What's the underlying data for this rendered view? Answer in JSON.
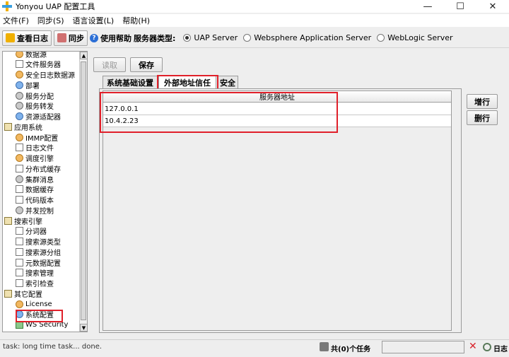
{
  "window": {
    "title": "Yonyou UAP 配置工具",
    "minimize": "—",
    "maximize": "☐",
    "close": "✕"
  },
  "menu": [
    "文件(F)",
    "同步(S)",
    "语言设置(L)",
    "帮助(H)"
  ],
  "toolbar": {
    "view_log": "查看日志",
    "sync": "同步",
    "help": "使用帮助",
    "server_type_label": "服务器类型:",
    "server_options": [
      {
        "label": "UAP Server",
        "selected": true
      },
      {
        "label": "Websphere Application Server",
        "selected": false
      },
      {
        "label": "WebLogic Server",
        "selected": false
      }
    ]
  },
  "tree": [
    {
      "label": "数据源",
      "icon": "datasource-icon",
      "level": 1
    },
    {
      "label": "文件服务器",
      "icon": "file-server-icon",
      "level": 1
    },
    {
      "label": "安全日志数据源",
      "icon": "datasource-icon",
      "level": 1
    },
    {
      "label": "部署",
      "icon": "deploy-icon",
      "level": 1
    },
    {
      "label": "服务分配",
      "icon": "service-icon",
      "level": 1
    },
    {
      "label": "服务转发",
      "icon": "service-icon",
      "level": 1
    },
    {
      "label": "资源适配器",
      "icon": "adapter-icon",
      "level": 1
    },
    {
      "label": "应用系统",
      "icon": "folder-icon",
      "level": 0
    },
    {
      "label": "IMMP配置",
      "icon": "config-icon",
      "level": 1
    },
    {
      "label": "日志文件",
      "icon": "log-icon",
      "level": 1
    },
    {
      "label": "调度引擎",
      "icon": "clock-icon",
      "level": 1
    },
    {
      "label": "分布式缓存",
      "icon": "doc-icon",
      "level": 1
    },
    {
      "label": "集群消息",
      "icon": "message-icon",
      "level": 1
    },
    {
      "label": "数据缓存",
      "icon": "cache-icon",
      "level": 1
    },
    {
      "label": "代码版本",
      "icon": "doc-icon",
      "level": 1
    },
    {
      "label": "并发控制",
      "icon": "list-icon",
      "level": 1
    },
    {
      "label": "搜索引擎",
      "icon": "folder-icon",
      "level": 0
    },
    {
      "label": "分词器",
      "icon": "doc-icon",
      "level": 1
    },
    {
      "label": "搜索源类型",
      "icon": "doc-icon",
      "level": 1
    },
    {
      "label": "搜索源分组",
      "icon": "doc-icon",
      "level": 1
    },
    {
      "label": "元数据配置",
      "icon": "doc-icon",
      "level": 1
    },
    {
      "label": "搜索管理",
      "icon": "doc-icon",
      "level": 1
    },
    {
      "label": "索引检查",
      "icon": "doc-icon",
      "level": 1
    },
    {
      "label": "其它配置",
      "icon": "folder-icon",
      "level": 0
    },
    {
      "label": "License",
      "icon": "license-icon",
      "level": 1
    },
    {
      "label": "系统配置",
      "icon": "system-config-icon",
      "level": 1
    },
    {
      "label": "WS Security",
      "icon": "globe-icon",
      "level": 1
    }
  ],
  "actions": {
    "read": "读取",
    "save": "保存",
    "add": "增行",
    "delete": "删行"
  },
  "tabs": [
    "系统基础设置",
    "外部地址信任",
    "安全"
  ],
  "active_tab": "外部地址信任",
  "table": {
    "header": "服务器地址",
    "rows": [
      "127.0.0.1",
      "10.4.2.23"
    ]
  },
  "status": {
    "message": "task: long time task... done.",
    "tasks": "共(0)个任务",
    "log": "日志"
  },
  "colors": {
    "highlight_border": "#e0202a",
    "background": "#eeeeee"
  }
}
